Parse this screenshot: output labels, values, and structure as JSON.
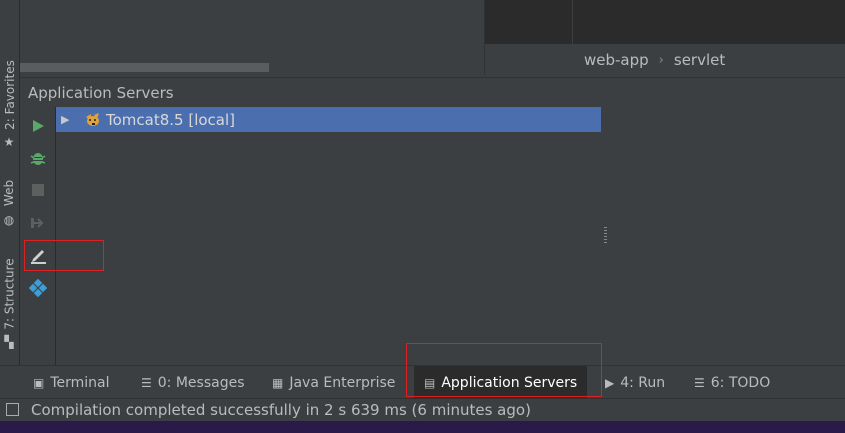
{
  "left_stripe": {
    "tabs": [
      {
        "label": "2: Favorites",
        "icon": "star-icon"
      },
      {
        "label": "Web",
        "icon": "globe-icon"
      },
      {
        "label": "7: Structure",
        "icon": "structure-icon"
      }
    ]
  },
  "breadcrumb": {
    "items": [
      "web-app",
      "servlet"
    ],
    "separator": "›"
  },
  "panel": {
    "title": "Application Servers",
    "toolbar": [
      "run-icon",
      "debug-icon",
      "stop-icon",
      "deploy-icon",
      "edit-configuration-icon",
      "artifact-icon"
    ],
    "servers": [
      {
        "label": "Tomcat8.5 [local]",
        "icon": "tomcat-icon",
        "selected": true
      }
    ]
  },
  "bottom_tabs": [
    {
      "label": "Terminal",
      "icon": "terminal-icon"
    },
    {
      "label": "0: Messages",
      "icon": "messages-icon"
    },
    {
      "label": "Java Enterprise",
      "icon": "java-enterprise-icon"
    },
    {
      "label": "Application Servers",
      "icon": "app-servers-icon",
      "active": true
    },
    {
      "label": "4: Run",
      "icon": "run-icon"
    },
    {
      "label": "6: TODO",
      "icon": "todo-icon"
    }
  ],
  "status": {
    "text": "Compilation completed successfully in 2 s 639 ms (6 minutes ago)"
  },
  "colors": {
    "selection": "#4b6eaf",
    "run": "#59a869",
    "annotation": "#e02020"
  }
}
